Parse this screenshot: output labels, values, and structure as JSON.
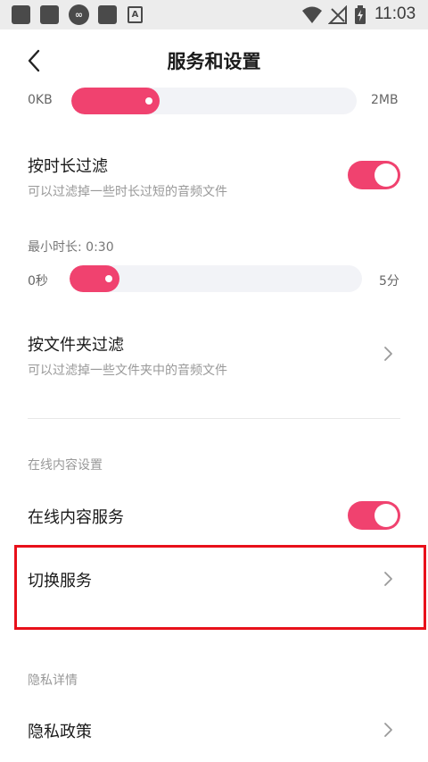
{
  "status_bar": {
    "time": "11:03",
    "left_icons": [
      "app-icon",
      "app-icon",
      "infinity-icon",
      "app-icon",
      "a-icon"
    ],
    "infinity_glyph": "∞",
    "a_glyph": "A"
  },
  "header": {
    "title": "服务和设置"
  },
  "size_slider": {
    "min_label": "0KB",
    "max_label": "2MB",
    "value_fraction": 0.31
  },
  "duration_filter": {
    "title": "按时长过滤",
    "subtitle": "可以过滤掉一些时长过短的音频文件",
    "enabled": true,
    "min_duration_label": "最小时长: 0:30",
    "slider_min": "0秒",
    "slider_max": "5分",
    "value_fraction": 0.17
  },
  "folder_filter": {
    "title": "按文件夹过滤",
    "subtitle": "可以过滤掉一些文件夹中的音频文件"
  },
  "online_section": {
    "section_label": "在线内容设置",
    "online_service_label": "在线内容服务",
    "online_service_enabled": true,
    "switch_service_label": "切换服务"
  },
  "privacy_section": {
    "section_label": "隐私详情",
    "privacy_policy_label": "隐私政策"
  },
  "colors": {
    "accent": "#f0426f",
    "highlight_box": "#e8101a"
  }
}
